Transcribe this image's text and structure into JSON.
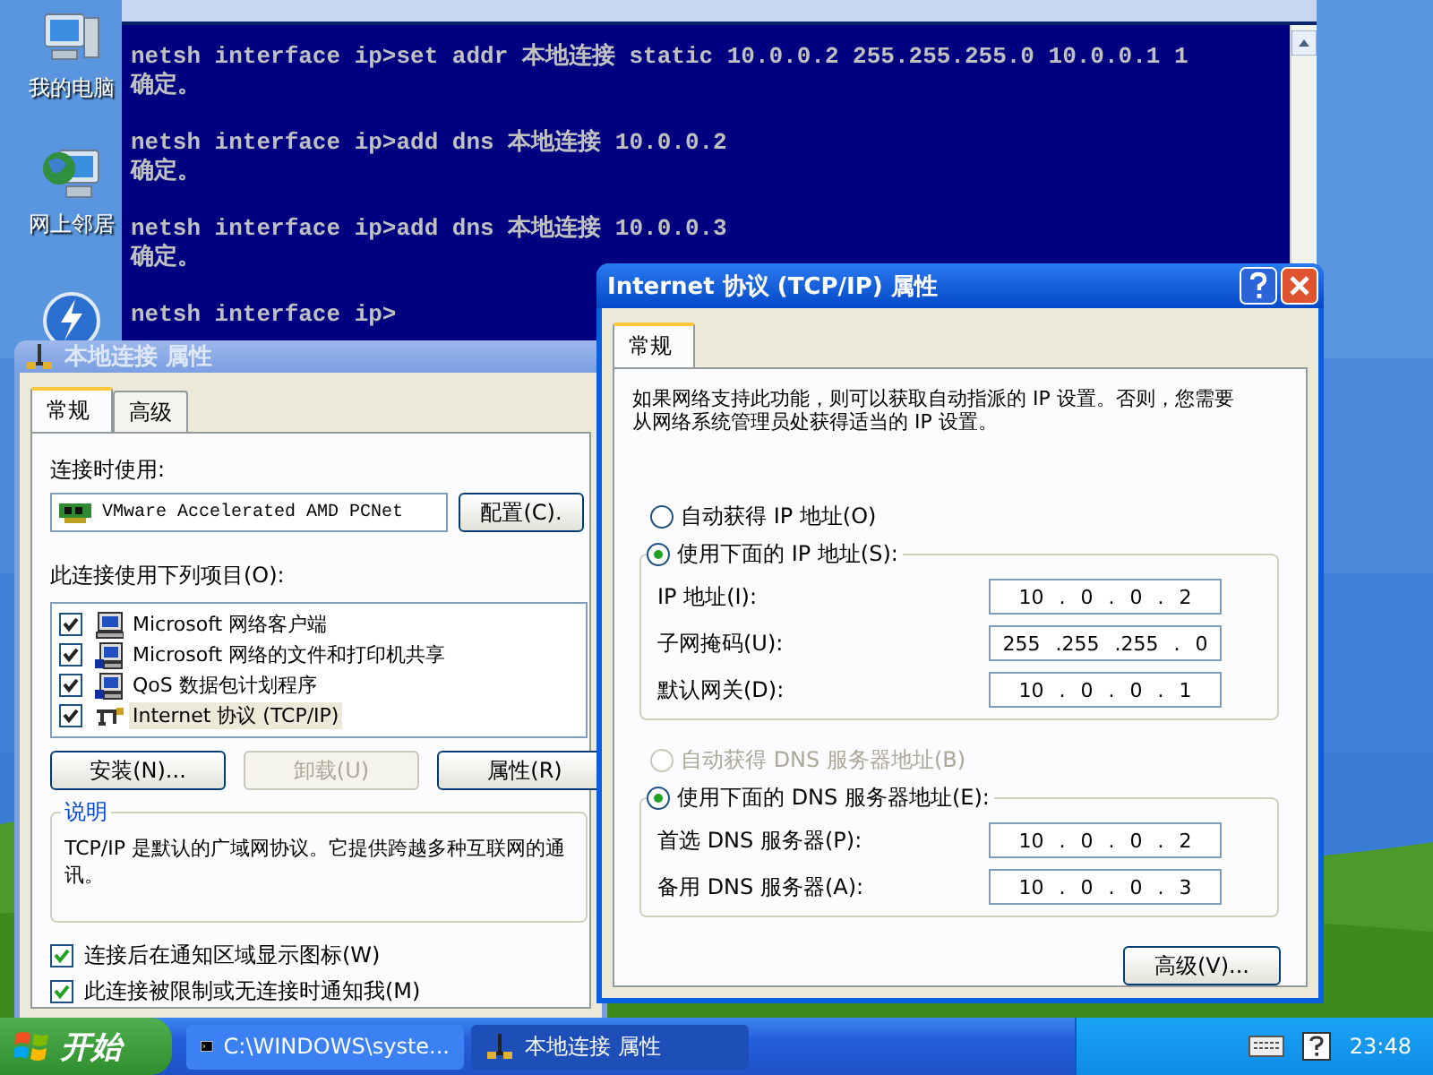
{
  "desktop_icons": [
    {
      "label": "我的电脑",
      "kind": "computer"
    },
    {
      "label": "网上邻居",
      "kind": "network"
    },
    {
      "kind": "lightning"
    }
  ],
  "console": {
    "blocks": [
      {
        "command": "netsh interface ip>set addr 本地连接 static 10.0.0.2 255.255.255.0 10.0.0.1 1",
        "result": "确定。"
      },
      {
        "command": "netsh interface ip>add dns 本地连接 10.0.0.2",
        "result": "确定。"
      },
      {
        "command": "netsh interface ip>add dns 本地连接 10.0.0.3",
        "result": "确定。"
      }
    ],
    "prompt": "netsh interface ip>"
  },
  "connection_dialog": {
    "title": "本地连接 属性",
    "tabs": [
      {
        "label": "常规",
        "selected": true
      },
      {
        "label": "高级",
        "selected": false
      }
    ],
    "connect_using_label": "连接时使用:",
    "adapter": "VMware Accelerated AMD PCNet",
    "configure_button": "配置(C).",
    "components_label": "此连接使用下列项目(O):",
    "components": [
      {
        "label": "Microsoft 网络客户端",
        "kind": "client",
        "checked": true,
        "selected": false
      },
      {
        "label": "Microsoft 网络的文件和打印机共享",
        "kind": "service",
        "checked": true,
        "selected": false
      },
      {
        "label": "QoS 数据包计划程序",
        "kind": "service",
        "checked": true,
        "selected": false
      },
      {
        "label": "Internet 协议 (TCP/IP)",
        "kind": "protocol",
        "checked": true,
        "selected": true
      }
    ],
    "buttons": [
      {
        "label": "安装(N)...",
        "disabled": false
      },
      {
        "label": "卸载(U)",
        "disabled": true
      },
      {
        "label": "属性(R)",
        "disabled": false
      }
    ],
    "description_title": "说明",
    "description": "TCP/IP 是默认的广域网协议。它提供跨越多种互联网的通讯。",
    "options": [
      {
        "label": "连接后在通知区域显示图标(W)",
        "checked": true
      },
      {
        "label": "此连接被限制或无连接时通知我(M)",
        "checked": true
      }
    ]
  },
  "tcpip_dialog": {
    "title": "Internet 协议 (TCP/IP) 属性",
    "tabs": [
      {
        "label": "常规",
        "selected": true
      }
    ],
    "intro": "如果网络支持此功能，则可以获取自动指派的 IP 设置。否则，您需要从网络系统管理员处获得适当的 IP 设置。",
    "ip_auto": {
      "label": "自动获得 IP 地址(O)",
      "selected": false,
      "disabled": false
    },
    "ip_manual": {
      "label": "使用下面的 IP 地址(S):",
      "selected": true,
      "disabled": false
    },
    "ip_fields": [
      {
        "label": "IP 地址(I):",
        "value": "10 . 0 . 0 . 2"
      },
      {
        "label": "子网掩码(U):",
        "value": "255 .255 .255 . 0"
      },
      {
        "label": "默认网关(D):",
        "value": "10 . 0 . 0 . 1"
      }
    ],
    "dns_auto": {
      "label": "自动获得 DNS 服务器地址(B)",
      "selected": false,
      "disabled": true
    },
    "dns_manual": {
      "label": "使用下面的 DNS 服务器地址(E):",
      "selected": true,
      "disabled": false
    },
    "dns_fields": [
      {
        "label": "首选 DNS 服务器(P):",
        "value": "10 . 0 . 0 . 2"
      },
      {
        "label": "备用 DNS 服务器(A):",
        "value": "10 . 0 . 0 . 3"
      }
    ],
    "advanced_button": "高级(V)..."
  },
  "taskbar": {
    "start": "开始",
    "tasks": [
      {
        "label": "C:\\WINDOWS\\syste...",
        "kind": "console",
        "selected": false
      },
      {
        "label": "本地连接 属性",
        "kind": "network",
        "selected": true
      }
    ],
    "clock": "23:48"
  }
}
